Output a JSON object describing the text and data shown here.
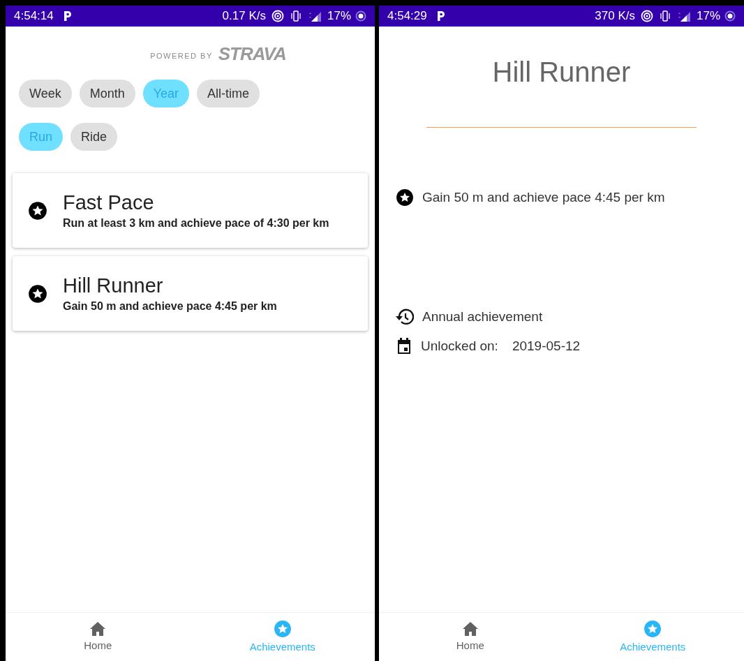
{
  "list_screen": {
    "status_bar": {
      "time": "4:54:14",
      "speed": "0.17 K/s",
      "battery": "17%"
    },
    "powered_by": "POWERED BY",
    "brand": "STRAVA",
    "period_filters": [
      {
        "label": "Week",
        "selected": false
      },
      {
        "label": "Month",
        "selected": false
      },
      {
        "label": "Year",
        "selected": true
      },
      {
        "label": "All-time",
        "selected": false
      }
    ],
    "sport_filters": [
      {
        "label": "Run",
        "selected": true
      },
      {
        "label": "Ride",
        "selected": false
      }
    ],
    "achievements": [
      {
        "title": "Fast Pace",
        "description": "Run at least 3 km and achieve pace of 4:30 per km"
      },
      {
        "title": "Hill Runner",
        "description": "Gain 50 m and achieve pace 4:45 per km"
      }
    ],
    "nav": [
      {
        "kind": "home",
        "label": "Home",
        "selected": false
      },
      {
        "kind": "star",
        "label": "Achievements",
        "selected": true
      }
    ]
  },
  "detail_screen": {
    "status_bar": {
      "time": "4:54:29",
      "speed": "370 K/s",
      "battery": "17%"
    },
    "title": "Hill Runner",
    "description": "Gain 50 m and achieve pace 4:45 per km",
    "period": "Annual achievement",
    "unlocked_label": "Unlocked on:",
    "unlocked_date": "2019-05-12",
    "nav": [
      {
        "kind": "home",
        "label": "Home",
        "selected": false
      },
      {
        "kind": "star",
        "label": "Achievements",
        "selected": true
      }
    ]
  }
}
